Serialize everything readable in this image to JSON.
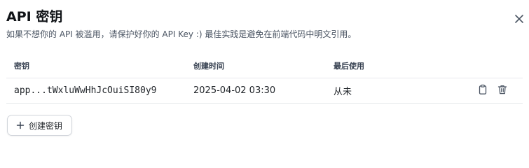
{
  "dialog": {
    "title": "API 密钥",
    "subtitle": "如果不想你的 API 被滥用，请保护好你的 API Key :) 最佳实践是避免在前端代码中明文引用。",
    "close_icon": "close-icon"
  },
  "table": {
    "columns": [
      "密钥",
      "创建时间",
      "最后使用"
    ],
    "rows": [
      {
        "key": "app...tWxluWwHhJcOuiSI80y9",
        "created": "2025-04-02 03:30",
        "last_used": "从未",
        "copy_icon": "clipboard-icon",
        "delete_icon": "trash-icon"
      }
    ]
  },
  "create_button": {
    "label": "创建密钥",
    "icon": "plus-icon"
  }
}
